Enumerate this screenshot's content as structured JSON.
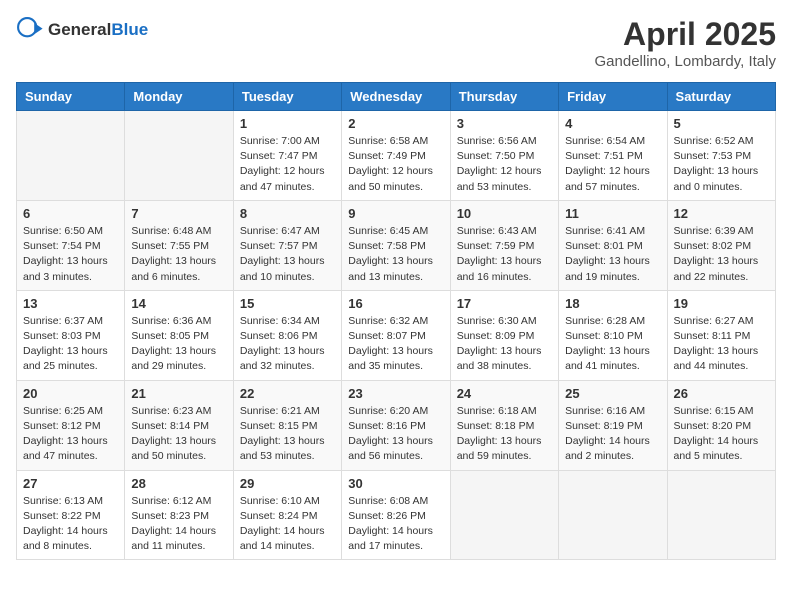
{
  "header": {
    "logo_general": "General",
    "logo_blue": "Blue",
    "month": "April 2025",
    "location": "Gandellino, Lombardy, Italy"
  },
  "weekdays": [
    "Sunday",
    "Monday",
    "Tuesday",
    "Wednesday",
    "Thursday",
    "Friday",
    "Saturday"
  ],
  "weeks": [
    [
      {
        "day": "",
        "info": ""
      },
      {
        "day": "",
        "info": ""
      },
      {
        "day": "1",
        "info": "Sunrise: 7:00 AM\nSunset: 7:47 PM\nDaylight: 12 hours and 47 minutes."
      },
      {
        "day": "2",
        "info": "Sunrise: 6:58 AM\nSunset: 7:49 PM\nDaylight: 12 hours and 50 minutes."
      },
      {
        "day": "3",
        "info": "Sunrise: 6:56 AM\nSunset: 7:50 PM\nDaylight: 12 hours and 53 minutes."
      },
      {
        "day": "4",
        "info": "Sunrise: 6:54 AM\nSunset: 7:51 PM\nDaylight: 12 hours and 57 minutes."
      },
      {
        "day": "5",
        "info": "Sunrise: 6:52 AM\nSunset: 7:53 PM\nDaylight: 13 hours and 0 minutes."
      }
    ],
    [
      {
        "day": "6",
        "info": "Sunrise: 6:50 AM\nSunset: 7:54 PM\nDaylight: 13 hours and 3 minutes."
      },
      {
        "day": "7",
        "info": "Sunrise: 6:48 AM\nSunset: 7:55 PM\nDaylight: 13 hours and 6 minutes."
      },
      {
        "day": "8",
        "info": "Sunrise: 6:47 AM\nSunset: 7:57 PM\nDaylight: 13 hours and 10 minutes."
      },
      {
        "day": "9",
        "info": "Sunrise: 6:45 AM\nSunset: 7:58 PM\nDaylight: 13 hours and 13 minutes."
      },
      {
        "day": "10",
        "info": "Sunrise: 6:43 AM\nSunset: 7:59 PM\nDaylight: 13 hours and 16 minutes."
      },
      {
        "day": "11",
        "info": "Sunrise: 6:41 AM\nSunset: 8:01 PM\nDaylight: 13 hours and 19 minutes."
      },
      {
        "day": "12",
        "info": "Sunrise: 6:39 AM\nSunset: 8:02 PM\nDaylight: 13 hours and 22 minutes."
      }
    ],
    [
      {
        "day": "13",
        "info": "Sunrise: 6:37 AM\nSunset: 8:03 PM\nDaylight: 13 hours and 25 minutes."
      },
      {
        "day": "14",
        "info": "Sunrise: 6:36 AM\nSunset: 8:05 PM\nDaylight: 13 hours and 29 minutes."
      },
      {
        "day": "15",
        "info": "Sunrise: 6:34 AM\nSunset: 8:06 PM\nDaylight: 13 hours and 32 minutes."
      },
      {
        "day": "16",
        "info": "Sunrise: 6:32 AM\nSunset: 8:07 PM\nDaylight: 13 hours and 35 minutes."
      },
      {
        "day": "17",
        "info": "Sunrise: 6:30 AM\nSunset: 8:09 PM\nDaylight: 13 hours and 38 minutes."
      },
      {
        "day": "18",
        "info": "Sunrise: 6:28 AM\nSunset: 8:10 PM\nDaylight: 13 hours and 41 minutes."
      },
      {
        "day": "19",
        "info": "Sunrise: 6:27 AM\nSunset: 8:11 PM\nDaylight: 13 hours and 44 minutes."
      }
    ],
    [
      {
        "day": "20",
        "info": "Sunrise: 6:25 AM\nSunset: 8:12 PM\nDaylight: 13 hours and 47 minutes."
      },
      {
        "day": "21",
        "info": "Sunrise: 6:23 AM\nSunset: 8:14 PM\nDaylight: 13 hours and 50 minutes."
      },
      {
        "day": "22",
        "info": "Sunrise: 6:21 AM\nSunset: 8:15 PM\nDaylight: 13 hours and 53 minutes."
      },
      {
        "day": "23",
        "info": "Sunrise: 6:20 AM\nSunset: 8:16 PM\nDaylight: 13 hours and 56 minutes."
      },
      {
        "day": "24",
        "info": "Sunrise: 6:18 AM\nSunset: 8:18 PM\nDaylight: 13 hours and 59 minutes."
      },
      {
        "day": "25",
        "info": "Sunrise: 6:16 AM\nSunset: 8:19 PM\nDaylight: 14 hours and 2 minutes."
      },
      {
        "day": "26",
        "info": "Sunrise: 6:15 AM\nSunset: 8:20 PM\nDaylight: 14 hours and 5 minutes."
      }
    ],
    [
      {
        "day": "27",
        "info": "Sunrise: 6:13 AM\nSunset: 8:22 PM\nDaylight: 14 hours and 8 minutes."
      },
      {
        "day": "28",
        "info": "Sunrise: 6:12 AM\nSunset: 8:23 PM\nDaylight: 14 hours and 11 minutes."
      },
      {
        "day": "29",
        "info": "Sunrise: 6:10 AM\nSunset: 8:24 PM\nDaylight: 14 hours and 14 minutes."
      },
      {
        "day": "30",
        "info": "Sunrise: 6:08 AM\nSunset: 8:26 PM\nDaylight: 14 hours and 17 minutes."
      },
      {
        "day": "",
        "info": ""
      },
      {
        "day": "",
        "info": ""
      },
      {
        "day": "",
        "info": ""
      }
    ]
  ]
}
